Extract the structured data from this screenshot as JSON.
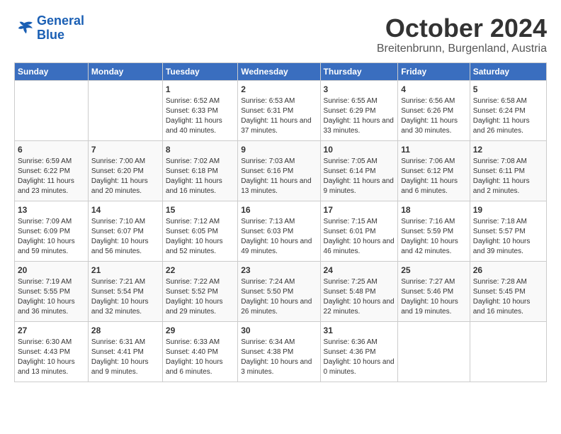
{
  "header": {
    "logo_line1": "General",
    "logo_line2": "Blue",
    "title": "October 2024",
    "subtitle": "Breitenbrunn, Burgenland, Austria"
  },
  "calendar": {
    "weekdays": [
      "Sunday",
      "Monday",
      "Tuesday",
      "Wednesday",
      "Thursday",
      "Friday",
      "Saturday"
    ],
    "weeks": [
      [
        {
          "day": "",
          "sunrise": "",
          "sunset": "",
          "daylight": ""
        },
        {
          "day": "",
          "sunrise": "",
          "sunset": "",
          "daylight": ""
        },
        {
          "day": "1",
          "sunrise": "Sunrise: 6:52 AM",
          "sunset": "Sunset: 6:33 PM",
          "daylight": "Daylight: 11 hours and 40 minutes."
        },
        {
          "day": "2",
          "sunrise": "Sunrise: 6:53 AM",
          "sunset": "Sunset: 6:31 PM",
          "daylight": "Daylight: 11 hours and 37 minutes."
        },
        {
          "day": "3",
          "sunrise": "Sunrise: 6:55 AM",
          "sunset": "Sunset: 6:29 PM",
          "daylight": "Daylight: 11 hours and 33 minutes."
        },
        {
          "day": "4",
          "sunrise": "Sunrise: 6:56 AM",
          "sunset": "Sunset: 6:26 PM",
          "daylight": "Daylight: 11 hours and 30 minutes."
        },
        {
          "day": "5",
          "sunrise": "Sunrise: 6:58 AM",
          "sunset": "Sunset: 6:24 PM",
          "daylight": "Daylight: 11 hours and 26 minutes."
        }
      ],
      [
        {
          "day": "6",
          "sunrise": "Sunrise: 6:59 AM",
          "sunset": "Sunset: 6:22 PM",
          "daylight": "Daylight: 11 hours and 23 minutes."
        },
        {
          "day": "7",
          "sunrise": "Sunrise: 7:00 AM",
          "sunset": "Sunset: 6:20 PM",
          "daylight": "Daylight: 11 hours and 20 minutes."
        },
        {
          "day": "8",
          "sunrise": "Sunrise: 7:02 AM",
          "sunset": "Sunset: 6:18 PM",
          "daylight": "Daylight: 11 hours and 16 minutes."
        },
        {
          "day": "9",
          "sunrise": "Sunrise: 7:03 AM",
          "sunset": "Sunset: 6:16 PM",
          "daylight": "Daylight: 11 hours and 13 minutes."
        },
        {
          "day": "10",
          "sunrise": "Sunrise: 7:05 AM",
          "sunset": "Sunset: 6:14 PM",
          "daylight": "Daylight: 11 hours and 9 minutes."
        },
        {
          "day": "11",
          "sunrise": "Sunrise: 7:06 AM",
          "sunset": "Sunset: 6:12 PM",
          "daylight": "Daylight: 11 hours and 6 minutes."
        },
        {
          "day": "12",
          "sunrise": "Sunrise: 7:08 AM",
          "sunset": "Sunset: 6:11 PM",
          "daylight": "Daylight: 11 hours and 2 minutes."
        }
      ],
      [
        {
          "day": "13",
          "sunrise": "Sunrise: 7:09 AM",
          "sunset": "Sunset: 6:09 PM",
          "daylight": "Daylight: 10 hours and 59 minutes."
        },
        {
          "day": "14",
          "sunrise": "Sunrise: 7:10 AM",
          "sunset": "Sunset: 6:07 PM",
          "daylight": "Daylight: 10 hours and 56 minutes."
        },
        {
          "day": "15",
          "sunrise": "Sunrise: 7:12 AM",
          "sunset": "Sunset: 6:05 PM",
          "daylight": "Daylight: 10 hours and 52 minutes."
        },
        {
          "day": "16",
          "sunrise": "Sunrise: 7:13 AM",
          "sunset": "Sunset: 6:03 PM",
          "daylight": "Daylight: 10 hours and 49 minutes."
        },
        {
          "day": "17",
          "sunrise": "Sunrise: 7:15 AM",
          "sunset": "Sunset: 6:01 PM",
          "daylight": "Daylight: 10 hours and 46 minutes."
        },
        {
          "day": "18",
          "sunrise": "Sunrise: 7:16 AM",
          "sunset": "Sunset: 5:59 PM",
          "daylight": "Daylight: 10 hours and 42 minutes."
        },
        {
          "day": "19",
          "sunrise": "Sunrise: 7:18 AM",
          "sunset": "Sunset: 5:57 PM",
          "daylight": "Daylight: 10 hours and 39 minutes."
        }
      ],
      [
        {
          "day": "20",
          "sunrise": "Sunrise: 7:19 AM",
          "sunset": "Sunset: 5:55 PM",
          "daylight": "Daylight: 10 hours and 36 minutes."
        },
        {
          "day": "21",
          "sunrise": "Sunrise: 7:21 AM",
          "sunset": "Sunset: 5:54 PM",
          "daylight": "Daylight: 10 hours and 32 minutes."
        },
        {
          "day": "22",
          "sunrise": "Sunrise: 7:22 AM",
          "sunset": "Sunset: 5:52 PM",
          "daylight": "Daylight: 10 hours and 29 minutes."
        },
        {
          "day": "23",
          "sunrise": "Sunrise: 7:24 AM",
          "sunset": "Sunset: 5:50 PM",
          "daylight": "Daylight: 10 hours and 26 minutes."
        },
        {
          "day": "24",
          "sunrise": "Sunrise: 7:25 AM",
          "sunset": "Sunset: 5:48 PM",
          "daylight": "Daylight: 10 hours and 22 minutes."
        },
        {
          "day": "25",
          "sunrise": "Sunrise: 7:27 AM",
          "sunset": "Sunset: 5:46 PM",
          "daylight": "Daylight: 10 hours and 19 minutes."
        },
        {
          "day": "26",
          "sunrise": "Sunrise: 7:28 AM",
          "sunset": "Sunset: 5:45 PM",
          "daylight": "Daylight: 10 hours and 16 minutes."
        }
      ],
      [
        {
          "day": "27",
          "sunrise": "Sunrise: 6:30 AM",
          "sunset": "Sunset: 4:43 PM",
          "daylight": "Daylight: 10 hours and 13 minutes."
        },
        {
          "day": "28",
          "sunrise": "Sunrise: 6:31 AM",
          "sunset": "Sunset: 4:41 PM",
          "daylight": "Daylight: 10 hours and 9 minutes."
        },
        {
          "day": "29",
          "sunrise": "Sunrise: 6:33 AM",
          "sunset": "Sunset: 4:40 PM",
          "daylight": "Daylight: 10 hours and 6 minutes."
        },
        {
          "day": "30",
          "sunrise": "Sunrise: 6:34 AM",
          "sunset": "Sunset: 4:38 PM",
          "daylight": "Daylight: 10 hours and 3 minutes."
        },
        {
          "day": "31",
          "sunrise": "Sunrise: 6:36 AM",
          "sunset": "Sunset: 4:36 PM",
          "daylight": "Daylight: 10 hours and 0 minutes."
        },
        {
          "day": "",
          "sunrise": "",
          "sunset": "",
          "daylight": ""
        },
        {
          "day": "",
          "sunrise": "",
          "sunset": "",
          "daylight": ""
        }
      ]
    ]
  }
}
